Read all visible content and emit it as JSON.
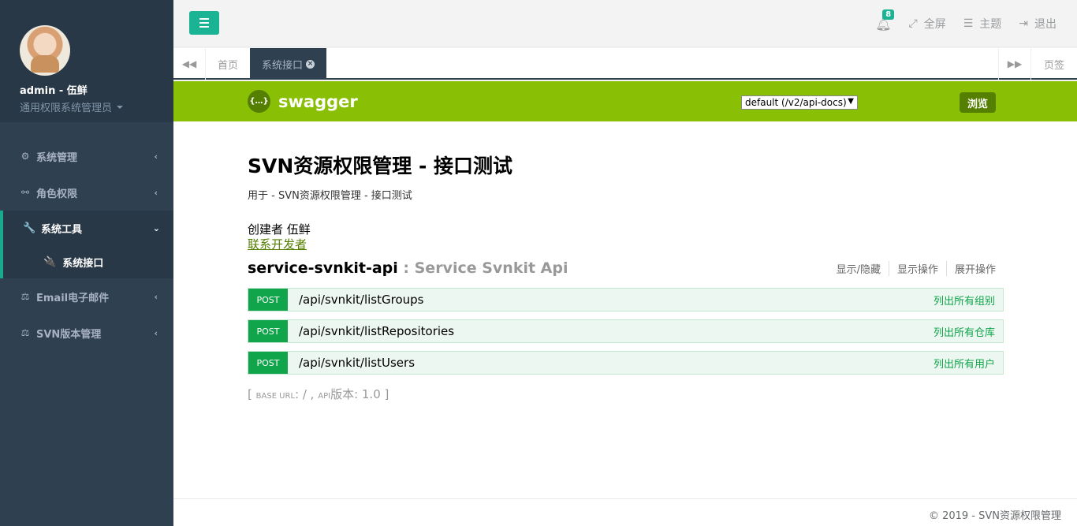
{
  "sidebar": {
    "user_name": "admin - 伍鲜",
    "user_role": "通用权限系统管理员",
    "items": [
      {
        "label": "系统管理",
        "icon": "gear-icon"
      },
      {
        "label": "角色权限",
        "icon": "share-nodes-icon"
      },
      {
        "label": "系统工具",
        "icon": "wrench-icon",
        "sub": "系统接口"
      },
      {
        "label": "Email电子邮件",
        "icon": "balance-scale-icon"
      },
      {
        "label": "SVN版本管理",
        "icon": "balance-scale-icon"
      }
    ]
  },
  "topbar": {
    "notification_count": "8",
    "fullscreen": "全屏",
    "theme": "主题",
    "logout": "退出"
  },
  "tabs": {
    "home": "首页",
    "active": "系统接口",
    "pages": "页签"
  },
  "swagger": {
    "logo_mark": "{…}",
    "logo_text": "swagger",
    "api_select": "default (/v2/api-docs)",
    "explore_label": "浏览"
  },
  "info": {
    "title": "SVN资源权限管理 - 接口测试",
    "description": "用于 - SVN资源权限管理 - 接口测试",
    "contact": "创建者 伍鲜",
    "contact_link": "联系开发者"
  },
  "resource": {
    "name": "service-svnkit-api",
    "subtitle": ": Service Svnkit Api",
    "ops_links": [
      "显示/隐藏",
      "显示操作",
      "展开操作"
    ],
    "operations": [
      {
        "method": "POST",
        "path": "/api/svnkit/listGroups",
        "summary": "列出所有组别"
      },
      {
        "method": "POST",
        "path": "/api/svnkit/listRepositories",
        "summary": "列出所有仓库"
      },
      {
        "method": "POST",
        "path": "/api/svnkit/listUsers",
        "summary": "列出所有用户"
      }
    ]
  },
  "base_url": {
    "open": "[",
    "base_label": "BASE URL",
    "base_value": ": / ,",
    "api_label": "API",
    "version_text": "版本: 1.0",
    "close": "]"
  },
  "footer": "© 2019 - SVN资源权限管理",
  "colors": {
    "sidebar_bg": "#2f4050",
    "accent": "#1ab394",
    "swagger_green": "#89bf04",
    "post_green": "#10a54a"
  }
}
